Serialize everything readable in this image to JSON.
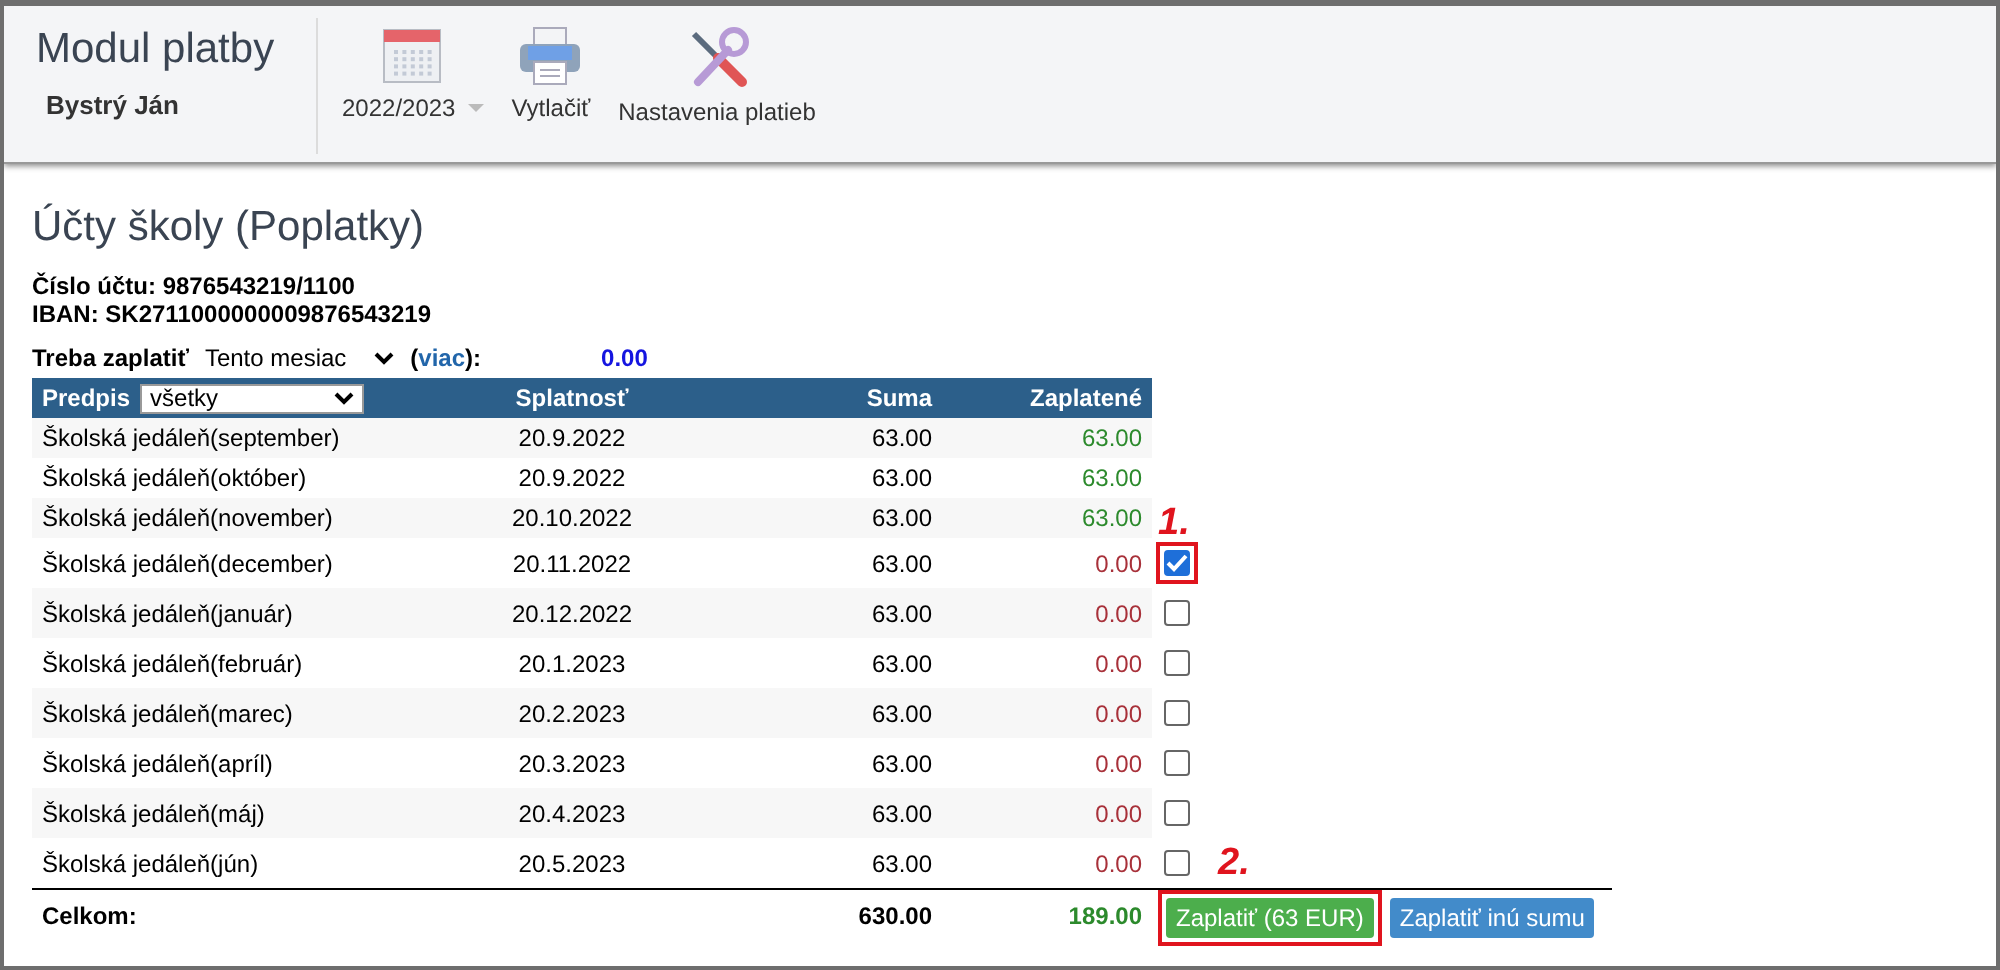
{
  "header": {
    "title": "Modul platby",
    "user": "Bystrý Ján",
    "toolbar": [
      {
        "kind": "calendar",
        "label": "2022/2023",
        "dropdown": true
      },
      {
        "kind": "printer",
        "label": "Vytlačiť",
        "dropdown": false
      },
      {
        "kind": "tools",
        "label": "Nastavenia platieb",
        "dropdown": false
      }
    ]
  },
  "section": {
    "title": "Účty školy (Poplatky)",
    "account": "Číslo účtu: 9876543219/1100",
    "iban": "IBAN: SK2711000000009876543219",
    "due_label": "Treba zaplatiť",
    "due_period": "Tento mesiac",
    "more_link": "viac",
    "due_colon": "):",
    "due_open": "(",
    "due_amount": "0.00"
  },
  "table": {
    "columns": [
      "Predpis",
      "Splatnosť",
      "Suma",
      "Zaplatené"
    ],
    "filter": "všetky",
    "rows": [
      {
        "name": "Školská jedáleň(september)",
        "due": "20.9.2022",
        "amount": "63.00",
        "paid": "63.00",
        "kind": "paid"
      },
      {
        "name": "Školská jedáleň(október)",
        "due": "20.9.2022",
        "amount": "63.00",
        "paid": "63.00",
        "kind": "paid"
      },
      {
        "name": "Školská jedáleň(november)",
        "due": "20.10.2022",
        "amount": "63.00",
        "paid": "63.00",
        "kind": "paid"
      },
      {
        "name": "Školská jedáleň(december)",
        "due": "20.11.2022",
        "amount": "63.00",
        "paid": "0.00",
        "kind": "unpaid",
        "checked": true,
        "annotation": "1."
      },
      {
        "name": "Školská jedáleň(január)",
        "due": "20.12.2022",
        "amount": "63.00",
        "paid": "0.00",
        "kind": "unpaid",
        "checked": false
      },
      {
        "name": "Školská jedáleň(február)",
        "due": "20.1.2023",
        "amount": "63.00",
        "paid": "0.00",
        "kind": "unpaid",
        "checked": false
      },
      {
        "name": "Školská jedáleň(marec)",
        "due": "20.2.2023",
        "amount": "63.00",
        "paid": "0.00",
        "kind": "unpaid",
        "checked": false
      },
      {
        "name": "Školská jedáleň(apríl)",
        "due": "20.3.2023",
        "amount": "63.00",
        "paid": "0.00",
        "kind": "unpaid",
        "checked": false
      },
      {
        "name": "Školská jedáleň(máj)",
        "due": "20.4.2023",
        "amount": "63.00",
        "paid": "0.00",
        "kind": "unpaid",
        "checked": false
      },
      {
        "name": "Školská jedáleň(jún)",
        "due": "20.5.2023",
        "amount": "63.00",
        "paid": "0.00",
        "kind": "unpaid",
        "checked": false
      }
    ],
    "total": {
      "label": "Celkom:",
      "amount": "630.00",
      "paid": "189.00"
    }
  },
  "buttons": [
    {
      "kind": "primary",
      "label": "Zaplatiť (63 EUR)",
      "annotation": "2."
    },
    {
      "kind": "secondary",
      "label": "Zaplatiť inú sumu"
    }
  ]
}
